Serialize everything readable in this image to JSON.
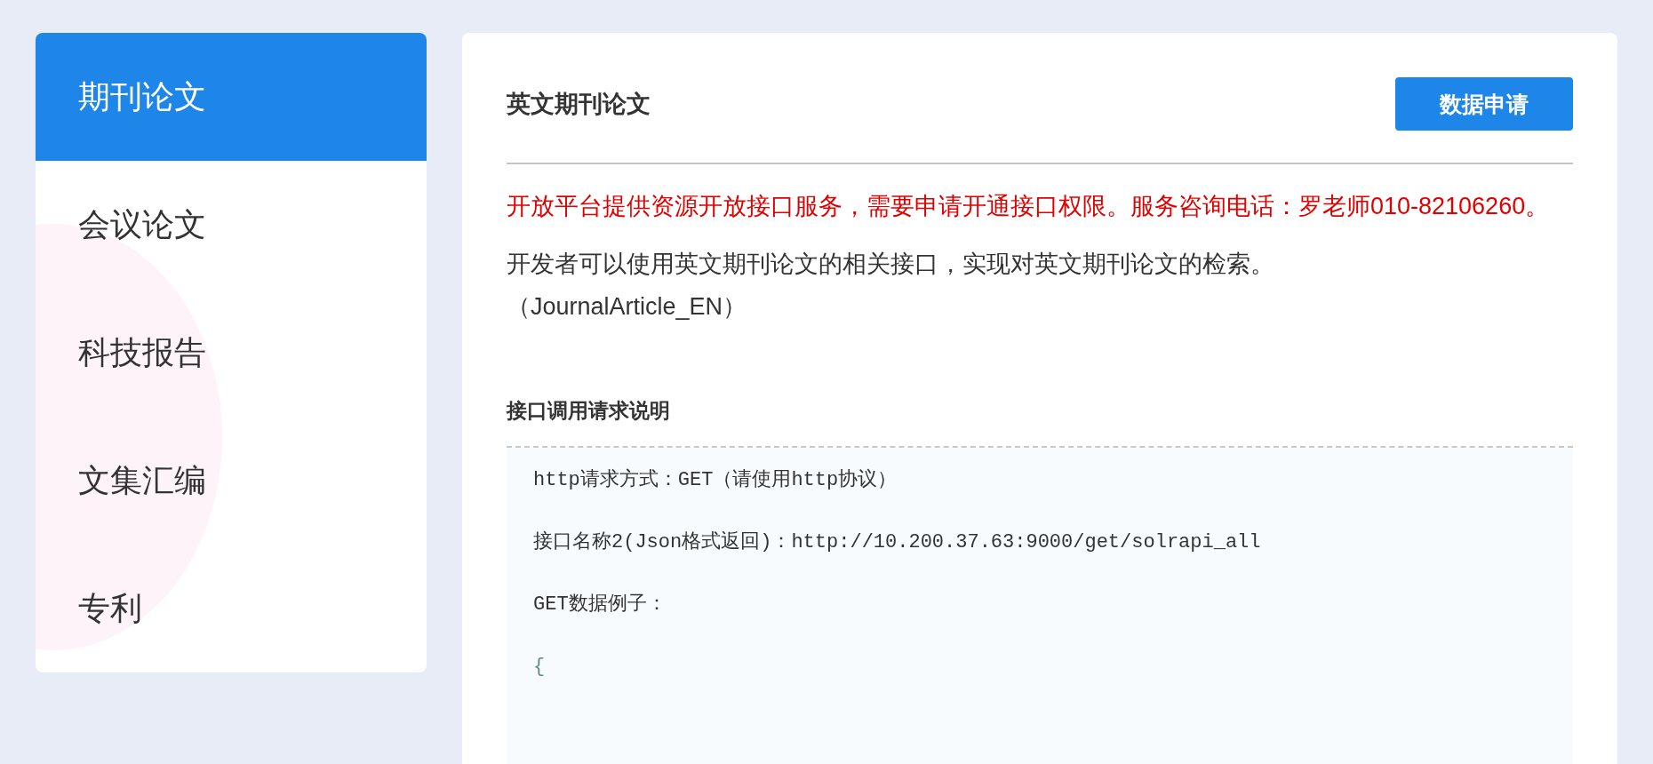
{
  "sidebar": {
    "items": [
      {
        "label": "期刊论文",
        "selected": true
      },
      {
        "label": "会议论文",
        "selected": false
      },
      {
        "label": "科技报告",
        "selected": false
      },
      {
        "label": "文集汇编",
        "selected": false
      },
      {
        "label": "专利",
        "selected": false
      }
    ]
  },
  "panel": {
    "title": "英文期刊论文",
    "apply_button": "数据申请",
    "notice": "开放平台提供资源开放接口服务，需要申请开通接口权限。服务咨询电话：罗老师010-82106260。",
    "description": "开发者可以使用英文期刊论文的相关接口，实现对英文期刊论文的检索。（JournalArticle_EN）",
    "section_title": "接口调用请求说明",
    "code_lines": [
      {
        "kind": "text",
        "text": "http请求方式：GET（请使用http协议）"
      },
      {
        "kind": "text",
        "text": "接口名称2(Json格式返回)：http://10.200.37.63:9000/get/solrapi_all"
      },
      {
        "kind": "text",
        "text": "GET数据例子："
      },
      {
        "kind": "brace",
        "text": "{"
      }
    ]
  }
}
